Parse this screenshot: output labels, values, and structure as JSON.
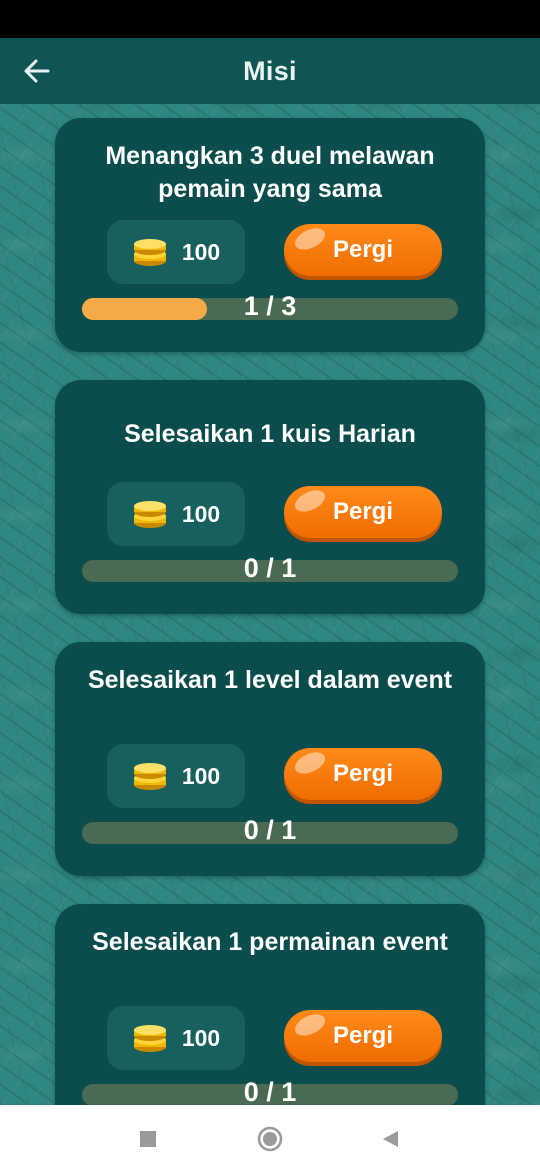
{
  "header": {
    "title": "Misi"
  },
  "missions": [
    {
      "title": "Menangkan 3 duel melawan pemain yang sama",
      "reward": "100",
      "button_label": "Pergi",
      "progress_text": "1 / 3",
      "progress_fraction": 0.333
    },
    {
      "title": "Selesaikan 1 kuis Harian",
      "reward": "100",
      "button_label": "Pergi",
      "progress_text": "0 / 1",
      "progress_fraction": 0
    },
    {
      "title": "Selesaikan 1 level dalam event",
      "reward": "100",
      "button_label": "Pergi",
      "progress_text": "0 / 1",
      "progress_fraction": 0
    },
    {
      "title": "Selesaikan 1 permainan event",
      "reward": "100",
      "button_label": "Pergi",
      "progress_text": "0 / 1",
      "progress_fraction": 0
    }
  ],
  "icons": {
    "back": "arrow-left-icon",
    "coin": "coin-stack-icon",
    "nav_recents": "square-icon",
    "nav_home": "circle-icon",
    "nav_back": "triangle-back-icon"
  },
  "colors": {
    "header": "#0f5553",
    "card": "#0b4d4c",
    "button": "#f47a0a",
    "progress_fill": "#f4aa48",
    "progress_track": "#4a6a51"
  }
}
